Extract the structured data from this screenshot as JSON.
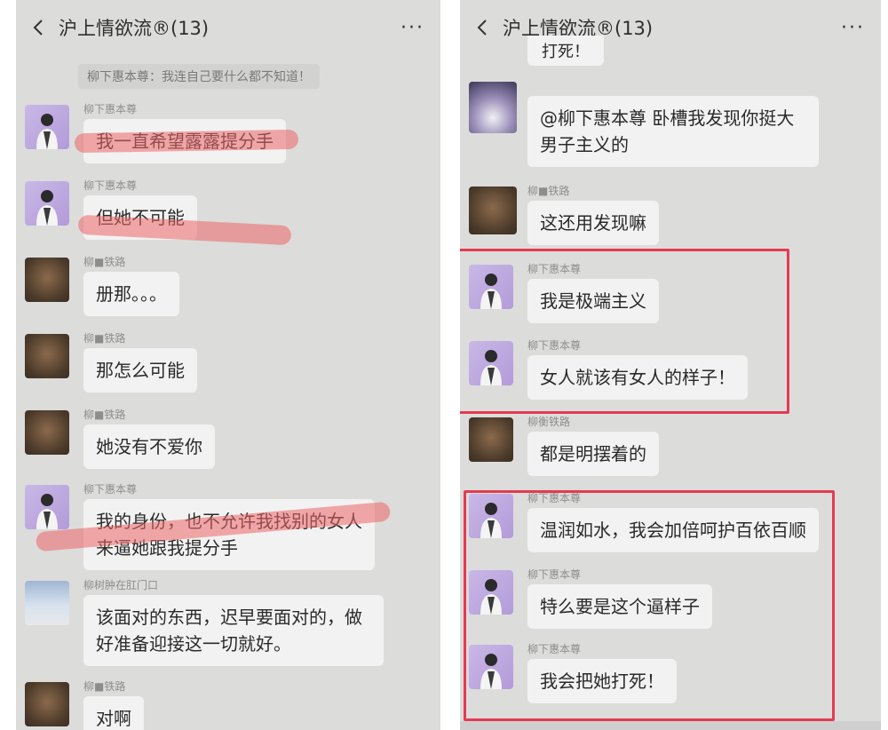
{
  "left": {
    "header": {
      "title": "沪上情欲流®(13)"
    },
    "system_note": "柳下惠本尊：我连自己要什么都不知道！",
    "messages": [
      {
        "sender": "柳下惠本尊",
        "text": "我一直希望露露提分手"
      },
      {
        "sender": "柳下惠本尊",
        "text": "但她不可能"
      },
      {
        "sender": "柳■铁路",
        "text": "册那。。。"
      },
      {
        "sender": "柳■铁路",
        "text": "那怎么可能"
      },
      {
        "sender": "柳■铁路",
        "text": "她没有不爱你"
      },
      {
        "sender": "柳下惠本尊",
        "text": "我的身份，也不允许我找别的女人来逼她跟我提分手"
      },
      {
        "sender": "柳树肿在肛门口",
        "text": "该面对的东西，迟早要面对的，做好准备迎接这一切就好。"
      },
      {
        "sender": "柳■铁路",
        "text": "对啊"
      }
    ]
  },
  "right": {
    "header": {
      "title": "沪上情欲流®(13)"
    },
    "partial_text": "打死！",
    "messages": [
      {
        "sender": "",
        "text": "@柳下惠本尊 卧槽我发现你挺大男子主义的"
      },
      {
        "sender": "柳■铁路",
        "text": "这还用发现嘛"
      },
      {
        "sender": "柳下惠本尊",
        "text": "我是极端主义"
      },
      {
        "sender": "柳下惠本尊",
        "text": "女人就该有女人的样子！"
      },
      {
        "sender": "柳衡铁路",
        "text": "都是明摆着的"
      },
      {
        "sender": "柳下惠本尊",
        "text": "温润如水，我会加倍呵护百依百顺"
      },
      {
        "sender": "柳下惠本尊",
        "text": "特么要是这个逼样子"
      },
      {
        "sender": "柳下惠本尊",
        "text": "我会把她打死！"
      }
    ]
  },
  "colors": {
    "highlight": "#ec6666",
    "redbox": "#e53a52",
    "bubble": "#f2f2f2",
    "background": "#dcdcdb"
  },
  "icons": {
    "back": "chevron-left-icon",
    "more": "more-dots-icon",
    "avatar": "person-icon"
  }
}
